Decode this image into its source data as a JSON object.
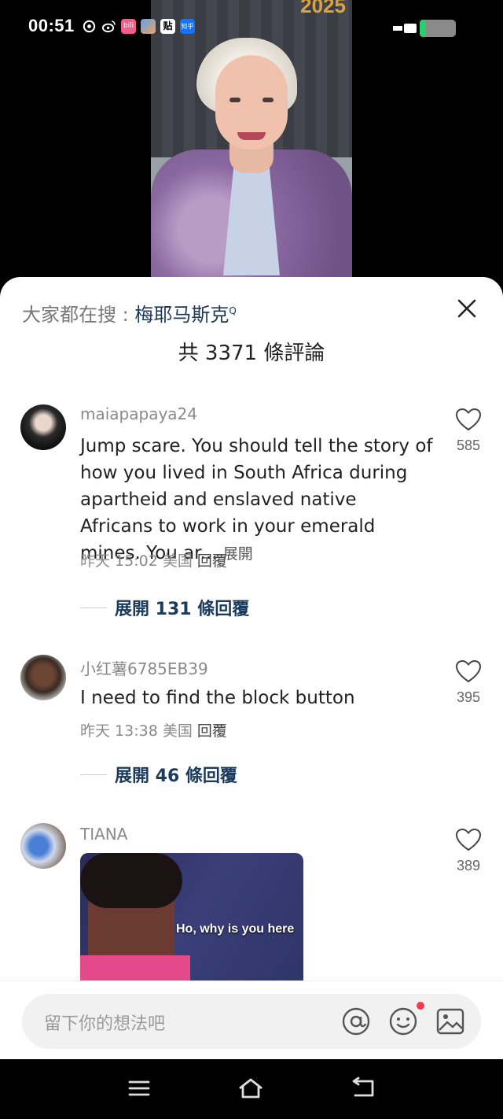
{
  "status_bar": {
    "time": "00:51",
    "app_icons": [
      "sync-icon",
      "weibo-icon",
      "bilibili-icon",
      "app-icon",
      "tieba-icon",
      "zhihu-icon"
    ],
    "tieba_label": "贴",
    "zhihu_label": "知乎",
    "bili_label": "bili",
    "battery_color": "#2ecc71"
  },
  "video": {
    "year_badge": "2025"
  },
  "sheet": {
    "search_prefix": "大家都在搜 : ",
    "search_term": "梅耶马斯克",
    "total_comments": "共 3371 條評論"
  },
  "comments": [
    {
      "username": "maiapapaya24",
      "text": "Jump scare. You should tell the story of how you lived in South Africa during apartheid and enslaved native Africans to work in your emerald mines. You ar...",
      "more_label": "展開",
      "time": "昨天 15:02",
      "location": "美国",
      "reply_label": "回覆",
      "likes": "585",
      "expand_label": "展開 131 條回覆"
    },
    {
      "username": "小红薯6785EB39",
      "text": "I need to find the block button",
      "time": "昨天 13:38",
      "location": "美国",
      "reply_label": "回覆",
      "likes": "395",
      "expand_label": "展開 46 條回覆"
    },
    {
      "username": "TIANA",
      "gif_caption": "Ho, why is you here",
      "likes": "389"
    }
  ],
  "input": {
    "placeholder": "留下你的想法吧"
  },
  "colors": {
    "accent": "#1b3a5c",
    "notification_dot": "#f43a4f"
  }
}
